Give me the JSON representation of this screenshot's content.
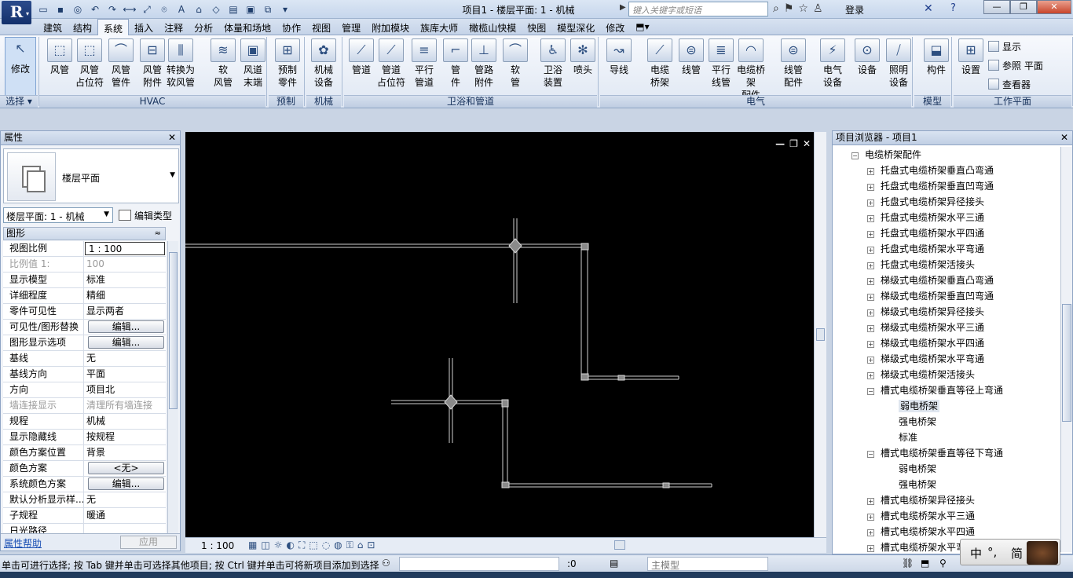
{
  "titlebar": {
    "app_logo": "R",
    "window_title": "项目1 - 楼层平面: 1 - 机械",
    "search_placeholder": "键入关键字或短语",
    "login": "登录",
    "minimize": "—",
    "maximize": "❐",
    "close": "✕"
  },
  "tabs": [
    "建筑",
    "结构",
    "系统",
    "插入",
    "注释",
    "分析",
    "体量和场地",
    "协作",
    "视图",
    "管理",
    "附加模块",
    "族库大师",
    "橄榄山快模",
    "快图",
    "模型深化",
    "修改"
  ],
  "active_tab": "系统",
  "ribbon": {
    "modify": "修改",
    "tools": [
      {
        "l1": "风管",
        "l2": ""
      },
      {
        "l1": "风管",
        "l2": "占位符"
      },
      {
        "l1": "风管",
        "l2": "管件"
      },
      {
        "l1": "风管",
        "l2": "附件"
      },
      {
        "l1": "转换为",
        "l2": "软风管"
      },
      {
        "l1": "软",
        "l2": "风管"
      },
      {
        "l1": "风道",
        "l2": "末端"
      },
      {
        "l1": "预制",
        "l2": "零件"
      },
      {
        "l1": "机械",
        "l2": "设备"
      },
      {
        "l1": "管道",
        "l2": ""
      },
      {
        "l1": "管道",
        "l2": "占位符"
      },
      {
        "l1": "平行",
        "l2": "管道"
      },
      {
        "l1": "管",
        "l2": "件"
      },
      {
        "l1": "管路",
        "l2": "附件"
      },
      {
        "l1": "软",
        "l2": "管"
      },
      {
        "l1": "卫浴",
        "l2": "装置"
      },
      {
        "l1": "喷头",
        "l2": ""
      },
      {
        "l1": "导线",
        "l2": ""
      },
      {
        "l1": "电缆",
        "l2": "桥架"
      },
      {
        "l1": "线管",
        "l2": ""
      },
      {
        "l1": "平行",
        "l2": "线管"
      },
      {
        "l1": "电缆桥架",
        "l2": "配件"
      },
      {
        "l1": "线管",
        "l2": "配件"
      },
      {
        "l1": "电气",
        "l2": "设备"
      },
      {
        "l1": "设备",
        "l2": ""
      },
      {
        "l1": "照明",
        "l2": "设备"
      },
      {
        "l1": "构件",
        "l2": ""
      },
      {
        "l1": "设置",
        "l2": ""
      }
    ],
    "workplane_small": [
      "显示",
      "参照 平面",
      "查看器"
    ],
    "panels": [
      "选择 ▾",
      "HVAC",
      "预制",
      "机械",
      "卫浴和管道",
      "电气",
      "模型",
      "工作平面"
    ]
  },
  "properties": {
    "title": "属性",
    "close": "✕",
    "type_name": "楼层平面",
    "instance": "楼层平面: 1 - 机械",
    "edit_type": "编辑类型",
    "section": "图形",
    "rows": [
      {
        "k": "视图比例",
        "v": "1 : 100"
      },
      {
        "k": "比例值 1:",
        "v": "100"
      },
      {
        "k": "显示模型",
        "v": "标准"
      },
      {
        "k": "详细程度",
        "v": "精细"
      },
      {
        "k": "零件可见性",
        "v": "显示两者"
      },
      {
        "k": "可见性/图形替换",
        "v": "编辑..."
      },
      {
        "k": "图形显示选项",
        "v": "编辑..."
      },
      {
        "k": "基线",
        "v": "无"
      },
      {
        "k": "基线方向",
        "v": "平面"
      },
      {
        "k": "方向",
        "v": "项目北"
      },
      {
        "k": "墙连接显示",
        "v": "清理所有墙连接"
      },
      {
        "k": "规程",
        "v": "机械"
      },
      {
        "k": "显示隐藏线",
        "v": "按规程"
      },
      {
        "k": "颜色方案位置",
        "v": "背景"
      },
      {
        "k": "颜色方案",
        "v": "<无>"
      },
      {
        "k": "系统颜色方案",
        "v": "编辑..."
      },
      {
        "k": "默认分析显示样...",
        "v": "无"
      },
      {
        "k": "子规程",
        "v": "暖通"
      },
      {
        "k": "日光路径",
        "v": ""
      }
    ],
    "help": "属性帮助",
    "apply": "应用"
  },
  "view": {
    "scale": "1 : 100",
    "ctrl": [
      "—",
      "❐",
      "✕"
    ]
  },
  "browser": {
    "title": "项目浏览器 - 项目1",
    "close": "✕",
    "nodes": [
      {
        "t": "电缆桥架配件",
        "lvl": 0,
        "tog": "−"
      },
      {
        "t": "托盘式电缆桥架垂直凸弯通",
        "lvl": 1,
        "tog": "+"
      },
      {
        "t": "托盘式电缆桥架垂直凹弯通",
        "lvl": 1,
        "tog": "+"
      },
      {
        "t": "托盘式电缆桥架异径接头",
        "lvl": 1,
        "tog": "+"
      },
      {
        "t": "托盘式电缆桥架水平三通",
        "lvl": 1,
        "tog": "+"
      },
      {
        "t": "托盘式电缆桥架水平四通",
        "lvl": 1,
        "tog": "+"
      },
      {
        "t": "托盘式电缆桥架水平弯通",
        "lvl": 1,
        "tog": "+"
      },
      {
        "t": "托盘式电缆桥架活接头",
        "lvl": 1,
        "tog": "+"
      },
      {
        "t": "梯级式电缆桥架垂直凸弯通",
        "lvl": 1,
        "tog": "+"
      },
      {
        "t": "梯级式电缆桥架垂直凹弯通",
        "lvl": 1,
        "tog": "+"
      },
      {
        "t": "梯级式电缆桥架异径接头",
        "lvl": 1,
        "tog": "+"
      },
      {
        "t": "梯级式电缆桥架水平三通",
        "lvl": 1,
        "tog": "+"
      },
      {
        "t": "梯级式电缆桥架水平四通",
        "lvl": 1,
        "tog": "+"
      },
      {
        "t": "梯级式电缆桥架水平弯通",
        "lvl": 1,
        "tog": "+"
      },
      {
        "t": "梯级式电缆桥架活接头",
        "lvl": 1,
        "tog": "+"
      },
      {
        "t": "槽式电缆桥架垂直等径上弯通",
        "lvl": 1,
        "tog": "−"
      },
      {
        "t": "弱电桥架",
        "lvl": 2,
        "tog": "",
        "sel": true
      },
      {
        "t": "强电桥架",
        "lvl": 2,
        "tog": ""
      },
      {
        "t": "标准",
        "lvl": 2,
        "tog": ""
      },
      {
        "t": "槽式电缆桥架垂直等径下弯通",
        "lvl": 1,
        "tog": "−"
      },
      {
        "t": "弱电桥架",
        "lvl": 2,
        "tog": ""
      },
      {
        "t": "强电桥架",
        "lvl": 2,
        "tog": ""
      },
      {
        "t": "槽式电缆桥架异径接头",
        "lvl": 1,
        "tog": "+"
      },
      {
        "t": "槽式电缆桥架水平三通",
        "lvl": 1,
        "tog": "+"
      },
      {
        "t": "槽式电缆桥架水平四通",
        "lvl": 1,
        "tog": "+"
      },
      {
        "t": "槽式电缆桥架水平弯通",
        "lvl": 1,
        "tog": "+"
      }
    ]
  },
  "ime": {
    "a": "中",
    "b": "简"
  },
  "status": {
    "text": "单击可进行选择; 按 Tab 键并单击可选择其他项目; 按 Ctrl 键并单击可将新项目添加到选择",
    "zero": ":0",
    "model": "主模型"
  },
  "colors": {
    "canvas": "#000000",
    "accent": "#2b4c8c"
  }
}
